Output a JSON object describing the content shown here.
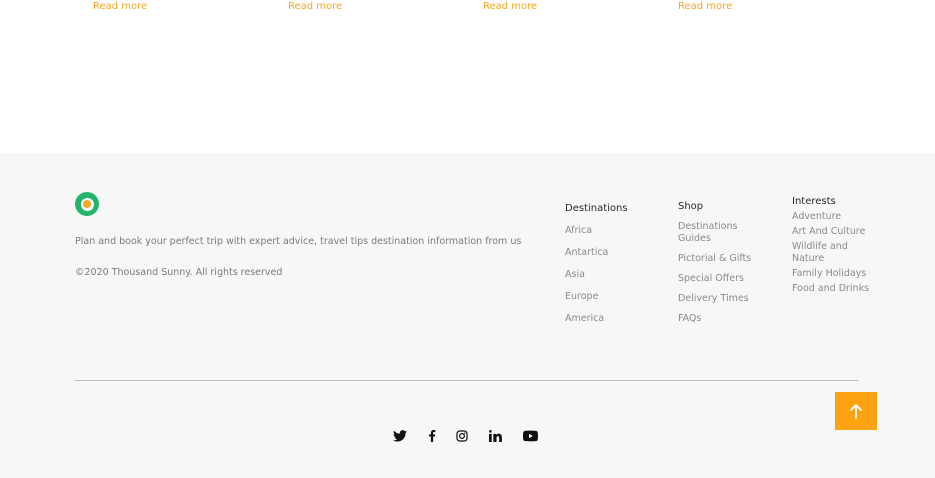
{
  "top": {
    "read_more": [
      "Read more",
      "Read more",
      "Read more",
      "Read more"
    ]
  },
  "footer": {
    "logo_icon": "logo-icon",
    "tagline": "Plan and book your perfect trip with expert advice, travel tips destination information from us",
    "copyright": "©2020 Thousand Sunny. All rights reserved",
    "columns": [
      {
        "title": "Destinations",
        "links": [
          "Africa",
          "Antartica",
          "Asia",
          "Europe",
          "America"
        ]
      },
      {
        "title": "Shop",
        "links": [
          "Destinations Guides",
          "Pictorial & Gifts",
          "Special Offers",
          "Delivery Times",
          "FAQs"
        ]
      },
      {
        "title": "Interests",
        "links": [
          "Adventure",
          "Art And Culture",
          "Wildlife and Nature",
          "Family Holidays",
          "Food and Drinks"
        ]
      }
    ],
    "social_icons": [
      "twitter-icon",
      "facebook-icon",
      "instagram-icon",
      "linkedin-icon",
      "youtube-icon"
    ],
    "back_to_top_icon": "arrow-up-icon",
    "colors": {
      "accent": "#f5a623",
      "button": "#fca311",
      "logo": "#26b36b",
      "footer_bg": "#f7f7f8"
    }
  }
}
